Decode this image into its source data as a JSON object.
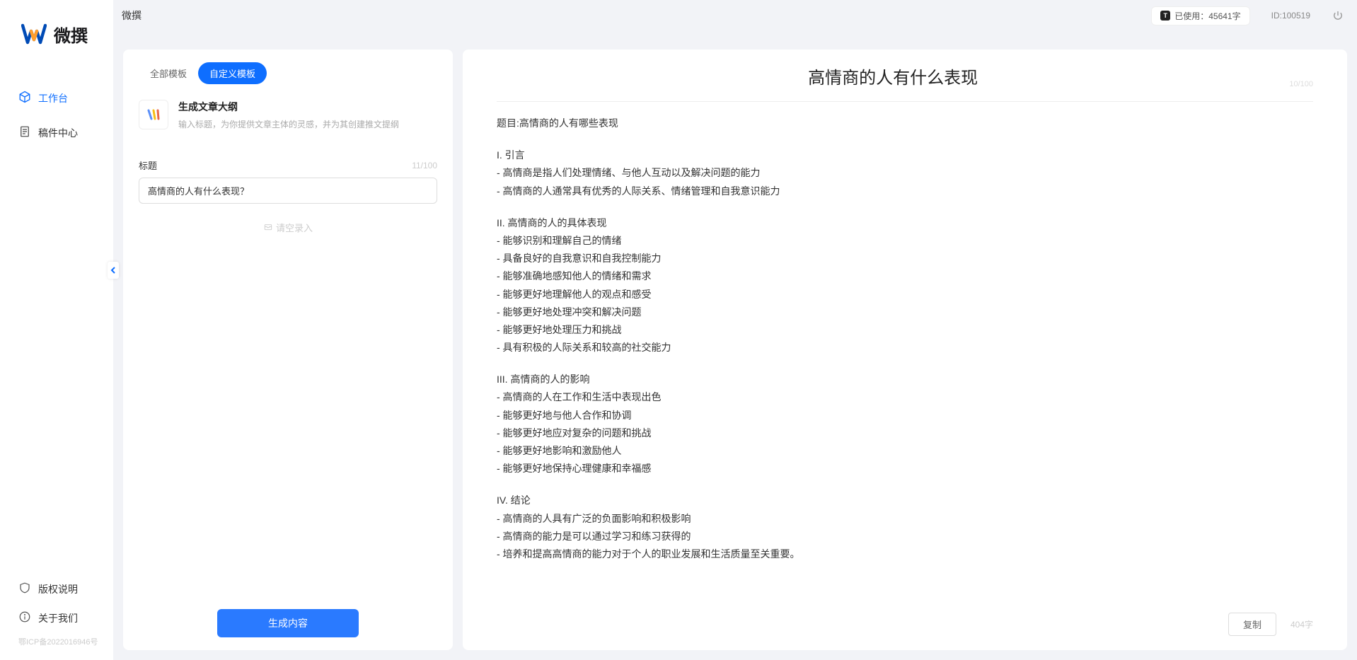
{
  "brand": {
    "name": "微撰"
  },
  "topbar": {
    "title": "微撰",
    "usage_label": "已使用：45641字",
    "user_id": "ID:100519"
  },
  "sidebar": {
    "items": [
      {
        "label": "工作台",
        "icon": "cube-icon",
        "active": true
      },
      {
        "label": "稿件中心",
        "icon": "document-icon",
        "active": false
      }
    ],
    "bottom": [
      {
        "label": "版权说明",
        "icon": "shield-icon"
      },
      {
        "label": "关于我们",
        "icon": "info-icon"
      }
    ],
    "icp": "鄂ICP备2022016946号"
  },
  "left_panel": {
    "tabs": [
      {
        "label": "全部模板",
        "active": false
      },
      {
        "label": "自定义模板",
        "active": true
      }
    ],
    "template": {
      "name": "生成文章大纲",
      "desc": "输入标题，为你提供文章主体的灵感，并为其创建推文提纲"
    },
    "title_label": "标题",
    "title_char_count": "11/100",
    "title_value": "高情商的人有什么表现？",
    "empty_hint": "请空录入",
    "generate_label": "生成内容"
  },
  "output": {
    "title": "高情商的人有什么表现",
    "title_count": "10/100",
    "copy_label": "复制",
    "word_count": "404字",
    "sections": [
      "题目:高情商的人有哪些表现",
      "I. 引言\n- 高情商是指人们处理情绪、与他人互动以及解决问题的能力\n- 高情商的人通常具有优秀的人际关系、情绪管理和自我意识能力",
      "II. 高情商的人的具体表现\n- 能够识别和理解自己的情绪\n- 具备良好的自我意识和自我控制能力\n- 能够准确地感知他人的情绪和需求\n- 能够更好地理解他人的观点和感受\n- 能够更好地处理冲突和解决问题\n- 能够更好地处理压力和挑战\n- 具有积极的人际关系和较高的社交能力",
      "III. 高情商的人的影响\n- 高情商的人在工作和生活中表现出色\n- 能够更好地与他人合作和协调\n- 能够更好地应对复杂的问题和挑战\n- 能够更好地影响和激励他人\n- 能够更好地保持心理健康和幸福感",
      "IV. 结论\n- 高情商的人具有广泛的负面影响和积极影响\n- 高情商的能力是可以通过学习和练习获得的\n- 培养和提高高情商的能力对于个人的职业发展和生活质量至关重要。"
    ]
  }
}
